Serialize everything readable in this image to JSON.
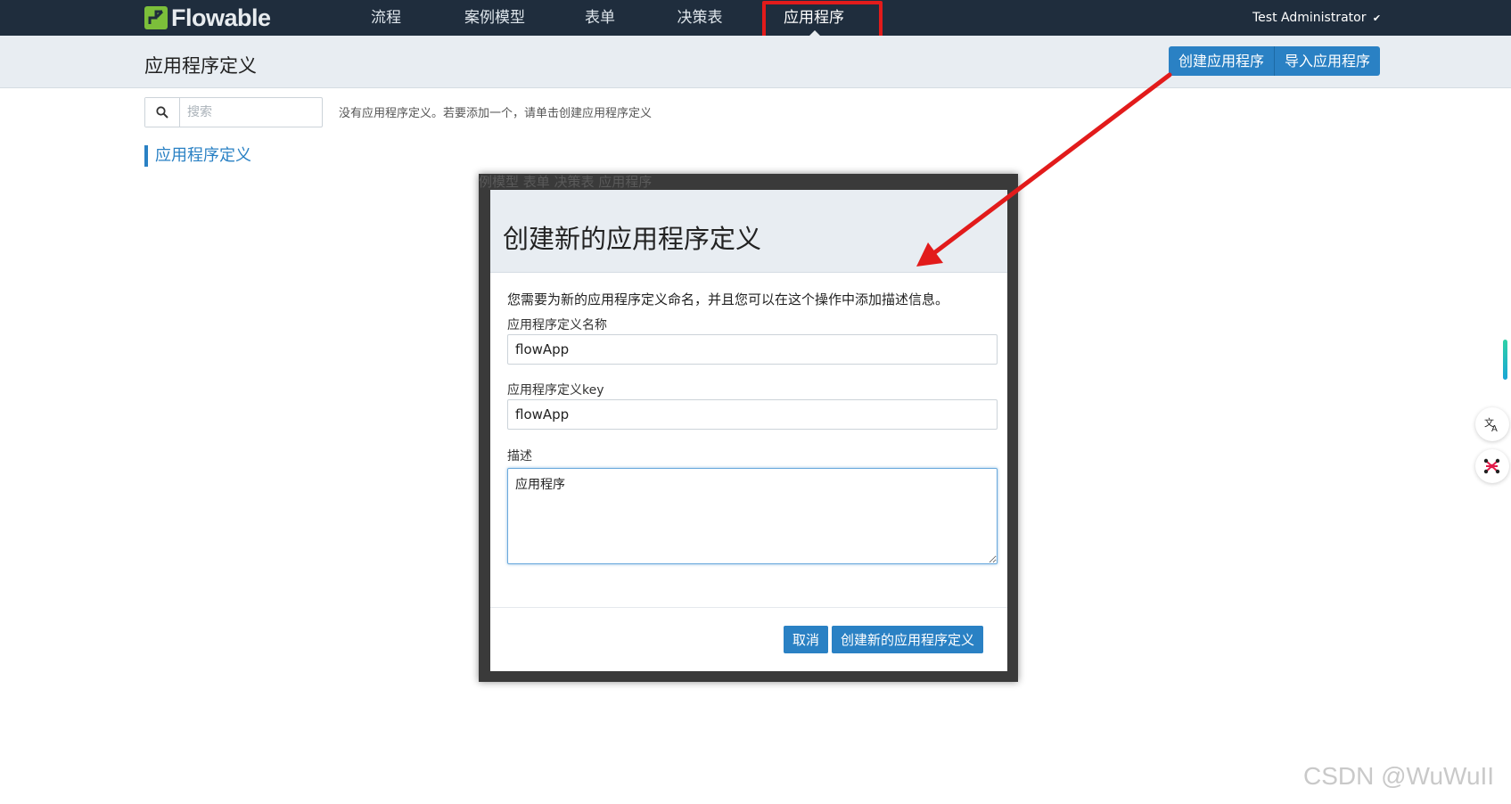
{
  "app": {
    "logo_text": "Flowable"
  },
  "nav": {
    "items": [
      {
        "label": "流程"
      },
      {
        "label": "案例模型"
      },
      {
        "label": "表单"
      },
      {
        "label": "决策表"
      },
      {
        "label": "应用程序"
      }
    ],
    "active": "应用程序",
    "user": "Test Administrator"
  },
  "header": {
    "title": "应用程序定义",
    "create_button": "创建应用程序",
    "import_button": "导入应用程序"
  },
  "search": {
    "placeholder": "搜索"
  },
  "main": {
    "empty_message": "没有应用程序定义。若要添加一个，请单击创建应用程序定义",
    "section_label": "应用程序定义"
  },
  "modal": {
    "backdrop_text": "例模型    表单    决策表    应用程序",
    "title": "创建新的应用程序定义",
    "intro": "您需要为新的应用程序定义命名，并且您可以在这个操作中添加描述信息。",
    "name_label": "应用程序定义名称",
    "name_value": "flowApp",
    "key_label": "应用程序定义key",
    "key_value": "flowApp",
    "description_label": "描述",
    "description_value": "应用程序",
    "cancel_button": "取消",
    "create_button": "创建新的应用程序定义"
  },
  "side_widgets": {
    "translate_icon": "translate-icon",
    "network_icon": "network-icon"
  },
  "watermark": "CSDN @WuWuII",
  "colors": {
    "nav_bg": "#1f2d3d",
    "accent": "#2a81c4",
    "header_bg": "#e8edf2",
    "annotation": "#e21b1b",
    "logo_green": "#7cbf3a"
  }
}
